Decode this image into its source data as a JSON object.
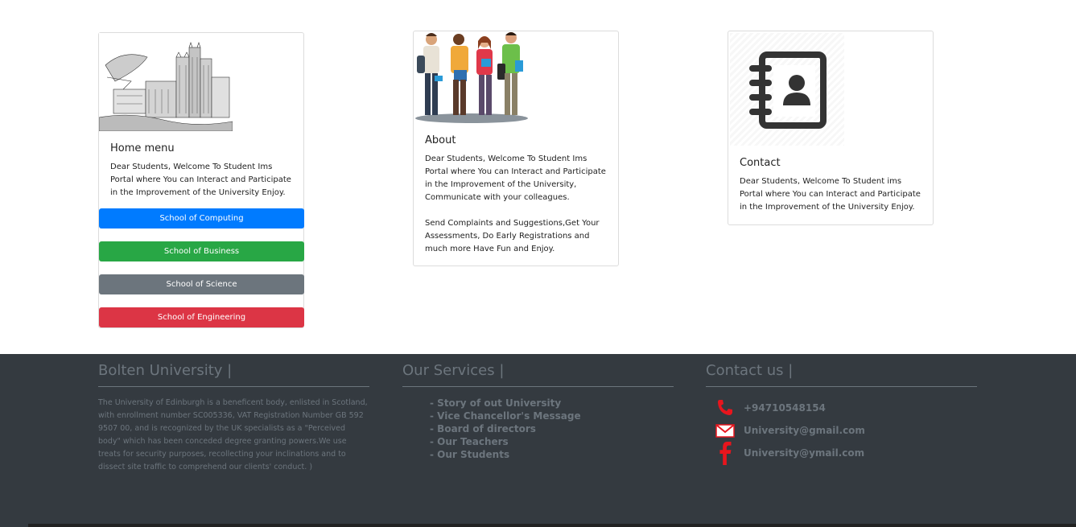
{
  "cards": {
    "home": {
      "title": "Home menu",
      "text": "Dear Students, Welcome To Student Ims Portal where You can Interact and Participate in the Improvement of the University Enjoy.",
      "buttons": [
        {
          "label": "School of Computing",
          "color": "#007bff"
        },
        {
          "label": "School of Business",
          "color": "#28a745"
        },
        {
          "label": "School of Science",
          "color": "#6c757d"
        },
        {
          "label": "School of Engineering",
          "color": "#dc3545"
        }
      ]
    },
    "about": {
      "title": "About",
      "text": "Dear Students, Welcome To Student Ims Portal where You can Interact and Participate in the Improvement of the University, Communicate with your colleagues.\n\nSend Complaints and Suggestions,Get Your Assessments, Do Early Registrations and much more Have Fun and Enjoy."
    },
    "contact": {
      "title": "Contact",
      "text": "Dear Students, Welcome To Student ims Portal where You can Interact and Participate in the Improvement of the University Enjoy."
    }
  },
  "footer": {
    "about": {
      "heading": "Bolten University |",
      "text": "The University of Edinburgh is a beneficent body, enlisted in Scotland, with enrollment number SC005336, VAT Registration Number GB 592 9507 00, and is recognized by the UK specialists as a \"Perceived body\" which has been conceded degree granting powers.We use treats for security purposes, recollecting your inclinations and to dissect site traffic to comprehend our clients' conduct. )"
    },
    "services": {
      "heading": "Our Services |",
      "items": [
        "Story of out University",
        "Vice Chancellor's Message",
        "Board of directors",
        "Our Teachers",
        "Our Students"
      ]
    },
    "contact": {
      "heading": "Contact us |",
      "phone": "+94710548154",
      "email": "University@gmail.com",
      "facebook": "University@ymail.com"
    }
  },
  "colors": {
    "footer_bg": "#343a40",
    "footer_text": "#6c757d",
    "icon_red": "#e8151d"
  }
}
